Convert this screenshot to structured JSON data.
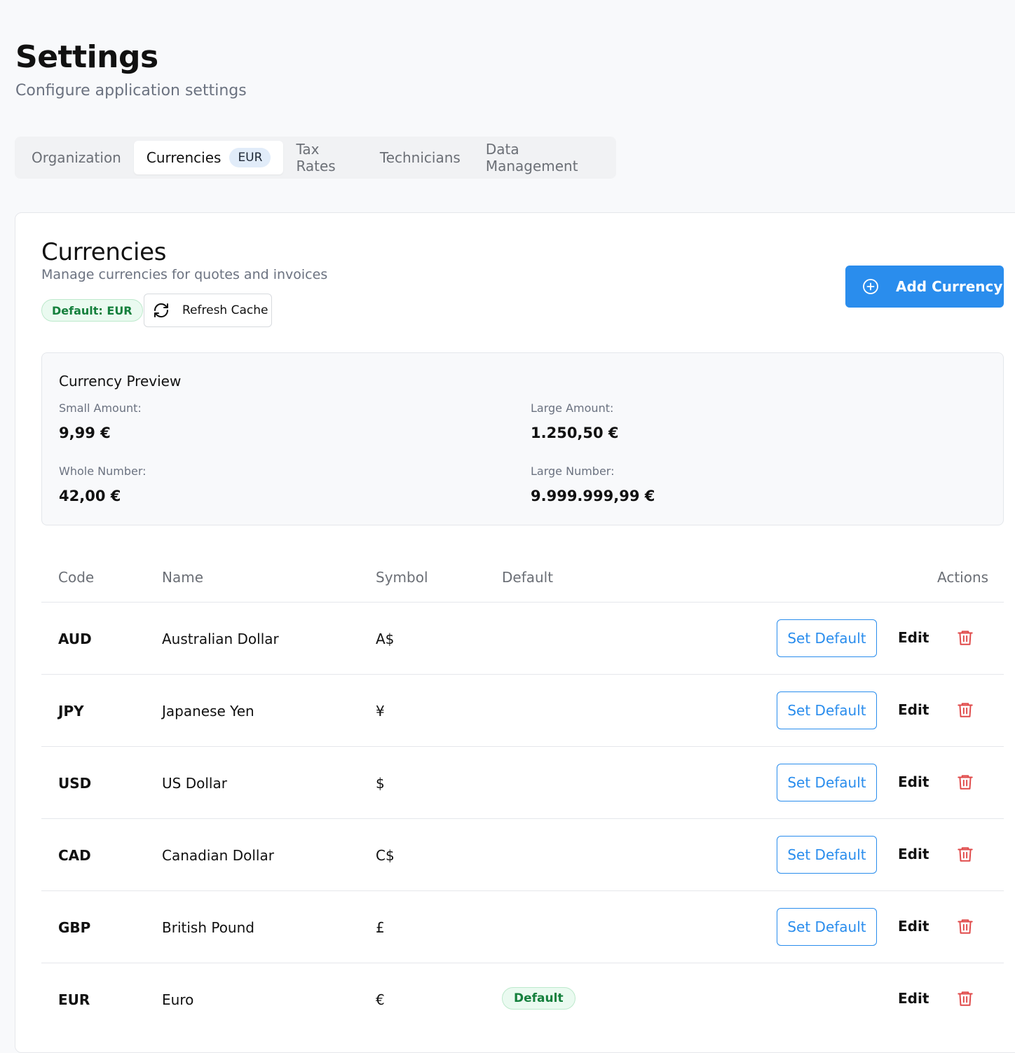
{
  "header": {
    "title": "Settings",
    "subtitle": "Configure application settings"
  },
  "tabs": [
    {
      "label": "Organization",
      "active": false
    },
    {
      "label": "Currencies",
      "active": true,
      "badge": "EUR"
    },
    {
      "label": "Tax Rates",
      "active": false
    },
    {
      "label": "Technicians",
      "active": false
    },
    {
      "label": "Data Management",
      "active": false
    }
  ],
  "currencies": {
    "title": "Currencies",
    "description": "Manage currencies for quotes and invoices",
    "default_pill": "Default: EUR",
    "refresh_label": "Refresh Cache",
    "add_label": "Add Currency",
    "preview": {
      "title": "Currency Preview",
      "small_label": "Small Amount:",
      "small_value": "9,99 €",
      "large_label": "Large Amount:",
      "large_value": "1.250,50 €",
      "whole_label": "Whole Number:",
      "whole_value": "42,00 €",
      "largenum_label": "Large Number:",
      "largenum_value": "9.999.999,99 €"
    },
    "columns": {
      "code": "Code",
      "name": "Name",
      "symbol": "Symbol",
      "default": "Default",
      "actions": "Actions"
    },
    "rows": [
      {
        "code": "AUD",
        "name": "Australian Dollar",
        "symbol": "A$",
        "is_default": false
      },
      {
        "code": "JPY",
        "name": "Japanese Yen",
        "symbol": "¥",
        "is_default": false
      },
      {
        "code": "USD",
        "name": "US Dollar",
        "symbol": "$",
        "is_default": false
      },
      {
        "code": "CAD",
        "name": "Canadian Dollar",
        "symbol": "C$",
        "is_default": false
      },
      {
        "code": "GBP",
        "name": "British Pound",
        "symbol": "£",
        "is_default": false
      },
      {
        "code": "EUR",
        "name": "Euro",
        "symbol": "€",
        "is_default": true
      }
    ],
    "set_default_label": "Set Default",
    "edit_label": "Edit",
    "default_badge_label": "Default"
  },
  "colors": {
    "accent": "#2a8ded",
    "success": "#15803d",
    "danger": "#e04a4a"
  },
  "icons": {
    "refresh": "refresh-icon",
    "add": "plus-circle-icon",
    "delete": "trash-icon"
  }
}
